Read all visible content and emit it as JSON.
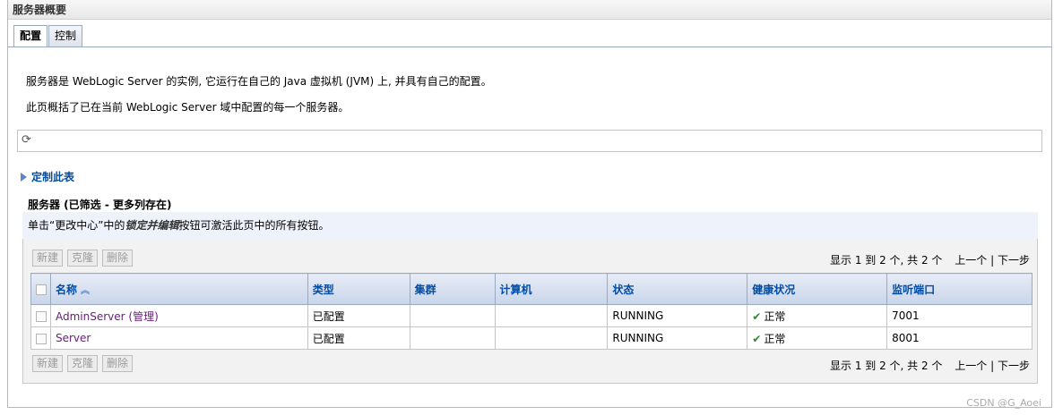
{
  "page_title": "服务器概要",
  "tabs": [
    {
      "label": "配置",
      "active": true
    },
    {
      "label": "控制",
      "active": false
    }
  ],
  "description": {
    "line1": "服务器是 WebLogic Server 的实例, 它运行在自己的 Java 虚拟机 (JVM) 上, 并具有自己的配置。",
    "line2": "此页概括了已在当前 WebLogic Server 域中配置的每一个服务器。"
  },
  "customize_label": "定制此表",
  "table_title": "服务器 (已筛选 - 更多列存在)",
  "note": {
    "prefix": "单击“更改中心”中的",
    "emph": "锁定并编辑",
    "suffix": "按钮可激活此页中的所有按钮。"
  },
  "buttons": {
    "new": "新建",
    "clone": "克隆",
    "delete": "删除"
  },
  "pager": {
    "summary": "显示 1 到 2 个, 共 2 个",
    "prev": "上一个",
    "sep": "|",
    "next": "下一步"
  },
  "columns": [
    "名称",
    "类型",
    "集群",
    "计算机",
    "状态",
    "健康状况",
    "监听端口"
  ],
  "rows": [
    {
      "name": "AdminServer (管理)",
      "type": "已配置",
      "cluster": "",
      "machine": "",
      "state": "RUNNING",
      "health": "正常",
      "port": "7001"
    },
    {
      "name": "Server",
      "type": "已配置",
      "cluster": "",
      "machine": "",
      "state": "RUNNING",
      "health": "正常",
      "port": "8001"
    }
  ],
  "watermark": "CSDN @G_Aoei",
  "colors": {
    "link": "#034ca0",
    "visited_link": "#6a1b7a",
    "header_bg": "#c9d5ea",
    "ok": "#2a8a2a"
  }
}
